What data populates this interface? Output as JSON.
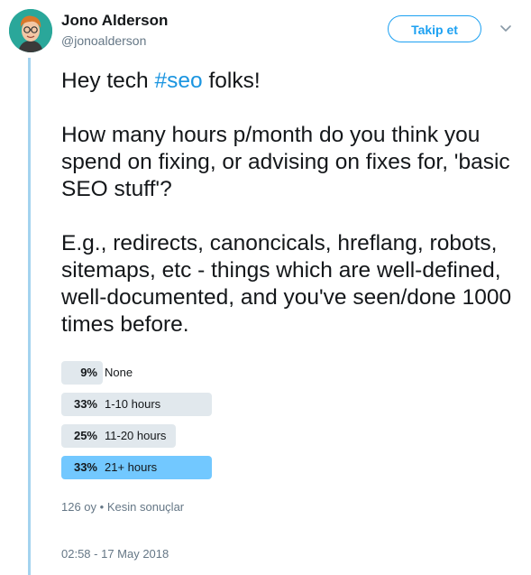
{
  "author": {
    "name": "Jono Alderson",
    "handle": "@jonoalderson",
    "avatar_icon": "user-avatar-icon"
  },
  "follow_button": {
    "label": "Takip et",
    "color": "#1da1f2"
  },
  "more_menu": {
    "icon": "chevron-down-icon"
  },
  "tweet": {
    "line1_prefix": "Hey tech ",
    "hashtag": "#seo",
    "line1_suffix": " folks!",
    "question": "How many hours p/month do you think you spend on fixing, or advising on fixes for, 'basic SEO stuff'?",
    "example": "E.g., redirects, canoncicals, hreflang, robots, sitemaps, etc - things which are well-defined, well-documented, and you've seen/done 1000 times before."
  },
  "poll": {
    "options": [
      {
        "percent": "9%",
        "label": "None",
        "fraction": 0.09,
        "winner": false
      },
      {
        "percent": "33%",
        "label": "1-10 hours",
        "fraction": 0.33,
        "winner": false
      },
      {
        "percent": "25%",
        "label": "11-20 hours",
        "fraction": 0.25,
        "winner": false
      },
      {
        "percent": "33%",
        "label": "21+ hours",
        "fraction": 0.33,
        "winner": true
      }
    ],
    "votes": "126 oy",
    "separator": "•",
    "status": "Kesin sonuçlar"
  },
  "timestamp": "02:58 - 17 May 2018",
  "colors": {
    "accent": "#1b95e0",
    "winner_bar": "#72c8ff",
    "bar": "#e1e8ed",
    "thread_line": "#a3d3ef"
  }
}
